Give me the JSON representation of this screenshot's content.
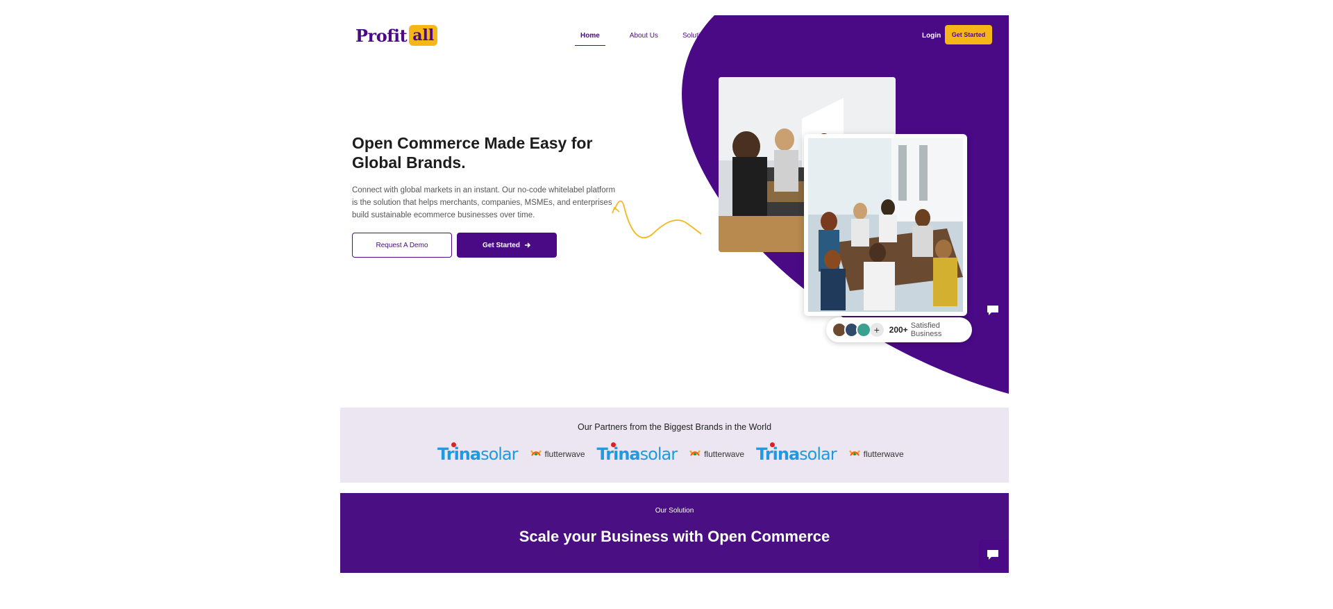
{
  "logo": {
    "part1": "Profit",
    "part2": "all"
  },
  "nav": {
    "items": [
      {
        "label": "Home",
        "active": true
      },
      {
        "label": "About Us",
        "active": false
      },
      {
        "label": "Solutions",
        "active": false
      }
    ],
    "login_label": "Login",
    "cta_label": "Get Started"
  },
  "hero": {
    "title": "Open Commerce Made Easy for Global Brands.",
    "description": "Connect with global markets in an instant. Our no-code whitelabel platform is the solution that helps merchants, companies, MSMEs, and enterprises build sustainable ecommerce businesses over time.",
    "demo_button": "Request A Demo",
    "start_button": "Get Started"
  },
  "badge": {
    "count": "200+",
    "text": "Satisfied Business"
  },
  "partners": {
    "title": "Our Partners from the Biggest Brands in the World",
    "logos": [
      {
        "trina_bold": "Trina",
        "trina_light": "solar",
        "flutter": "flutterwave"
      },
      {
        "trina_bold": "Trina",
        "trina_light": "solar",
        "flutter": "flutterwave"
      },
      {
        "trina_bold": "Trina",
        "trina_light": "solar",
        "flutter": "flutterwave"
      }
    ]
  },
  "solution": {
    "label": "Our Solution",
    "title": "Scale your Business with Open Commerce"
  },
  "colors": {
    "brand_purple": "#4a0a86",
    "accent_yellow": "#f7b617",
    "partners_bg": "#ebe6f2"
  }
}
